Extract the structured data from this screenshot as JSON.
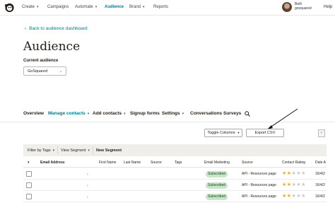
{
  "nav": {
    "items": [
      {
        "label": "Create",
        "caret": true
      },
      {
        "label": "Campaigns",
        "caret": false
      },
      {
        "label": "Automate",
        "caret": true
      },
      {
        "label": "Audience",
        "caret": false,
        "active": true
      },
      {
        "label": "Brand",
        "caret": true
      },
      {
        "label": "Reports",
        "caret": false
      }
    ],
    "user_name": "Beth",
    "user_org": "gosquared",
    "help": "Help"
  },
  "header": {
    "back_link": "Back to audience dashboard",
    "title": "Audience",
    "current_label": "Current audience",
    "audience_selected": "GoSquared"
  },
  "tabs": [
    {
      "label": "Overview"
    },
    {
      "label": "Manage contacts",
      "active": true,
      "caret": true
    },
    {
      "label": "Add contacts",
      "caret": true
    },
    {
      "label": "Signup forms"
    },
    {
      "label": "Settings",
      "caret": true
    },
    {
      "label": "Conversations"
    },
    {
      "label": "Surveys"
    }
  ],
  "actions": {
    "toggle_columns": "Toggle Columns",
    "export_csv": "Export CSV"
  },
  "filterbar": {
    "filter_by_tags": "Filter by Tags",
    "view_segment": "View Segment",
    "new_segment": "New Segment"
  },
  "table": {
    "columns": [
      "Email Address",
      "First Name",
      "Last Name",
      "Source",
      "Tags",
      "Email Marketing",
      "Source",
      "Contact Rating",
      "Date A"
    ],
    "rows": [
      {
        "email_marketing": "Subscribed",
        "source": "API - Resources page",
        "rating": 2,
        "date": "16/4/2"
      },
      {
        "email_marketing": "Subscribed",
        "source": "API - Resources page",
        "rating": 2,
        "date": "16/4/2"
      },
      {
        "email_marketing": "Subscribed",
        "source": "API - Resources page",
        "rating": 2,
        "date": "16/4/2"
      }
    ]
  },
  "colors": {
    "accent": "#007c89",
    "badge_bg": "#c6e6c7",
    "filterbar_bg": "#efeeea",
    "star": "#e9b400"
  },
  "icons": [
    "mailchimp-logo-icon",
    "chevron-down-icon",
    "back-arrow-icon",
    "search-icon",
    "chevron-right-icon",
    "star-icon"
  ]
}
